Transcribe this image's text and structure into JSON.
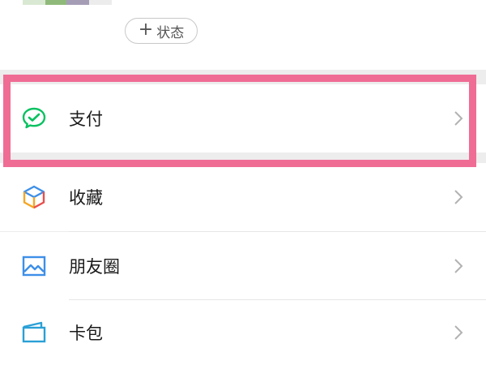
{
  "profile": {
    "status_button": {
      "plus": "+",
      "label": "状态"
    },
    "avatar_colors": [
      "#d9e8d2",
      "#8fb97a",
      "#a59db6",
      "#ececec"
    ]
  },
  "menu": {
    "payment": {
      "label": "支付",
      "icon": "wechat-pay-icon",
      "icon_color": "#07c160"
    },
    "favorites": {
      "label": "收藏",
      "icon": "cube-icon"
    },
    "moments": {
      "label": "朋友圈",
      "icon": "image-icon",
      "icon_color": "#3d8fe8"
    },
    "cards": {
      "label": "卡包",
      "icon": "card-wallet-icon",
      "icon_color": "#2aa0d6"
    }
  },
  "highlight_color": "#ef6c95"
}
